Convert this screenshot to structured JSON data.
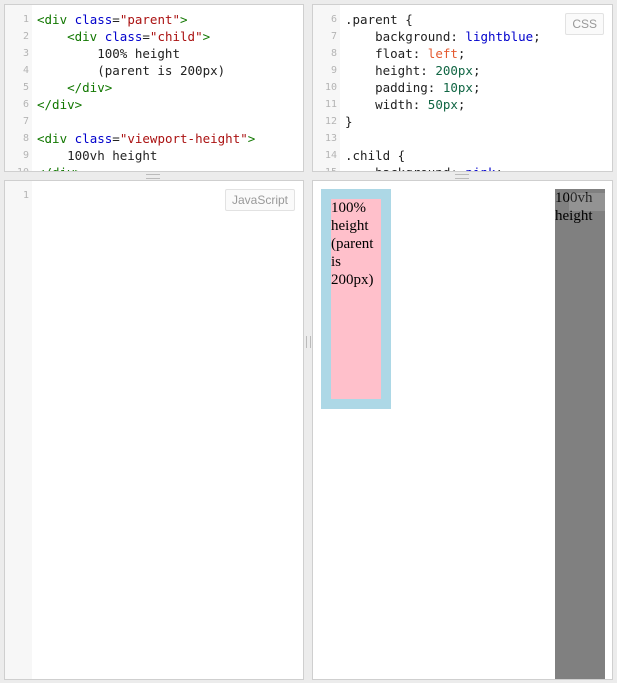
{
  "html_pane": {
    "label": "",
    "lines": [
      {
        "n": "1",
        "parts": [
          [
            "t",
            "<div "
          ],
          [
            "a",
            "class"
          ],
          [
            "p",
            "="
          ],
          [
            "s",
            "\"parent\""
          ],
          [
            "t",
            ">"
          ]
        ]
      },
      {
        "n": "2",
        "parts": [
          [
            "p",
            "    "
          ],
          [
            "t",
            "<div "
          ],
          [
            "a",
            "class"
          ],
          [
            "p",
            "="
          ],
          [
            "s",
            "\"child\""
          ],
          [
            "t",
            ">"
          ]
        ]
      },
      {
        "n": "3",
        "parts": [
          [
            "p",
            "        100% height"
          ]
        ]
      },
      {
        "n": "4",
        "parts": [
          [
            "p",
            "        (parent is 200px)"
          ]
        ]
      },
      {
        "n": "5",
        "parts": [
          [
            "p",
            "    "
          ],
          [
            "t",
            "</div>"
          ]
        ]
      },
      {
        "n": "6",
        "parts": [
          [
            "t",
            "</div>"
          ]
        ]
      },
      {
        "n": "7",
        "parts": [
          [
            "p",
            ""
          ]
        ]
      },
      {
        "n": "8",
        "parts": [
          [
            "t",
            "<div "
          ],
          [
            "a",
            "class"
          ],
          [
            "p",
            "="
          ],
          [
            "s",
            "\"viewport-height\""
          ],
          [
            "t",
            ">"
          ]
        ]
      },
      {
        "n": "9",
        "parts": [
          [
            "p",
            "    100vh height"
          ]
        ]
      },
      {
        "n": "10",
        "parts": [
          [
            "t",
            "</div>"
          ]
        ]
      }
    ]
  },
  "css_pane": {
    "label": "CSS",
    "lines": [
      {
        "n": "6",
        "parts": [
          [
            "p",
            ".parent {"
          ]
        ]
      },
      {
        "n": "7",
        "parts": [
          [
            "p",
            "    background: "
          ],
          [
            "kw",
            "lightblue"
          ],
          [
            "p",
            ";"
          ]
        ]
      },
      {
        "n": "8",
        "parts": [
          [
            "p",
            "    float: "
          ],
          [
            "red",
            "left"
          ],
          [
            "p",
            ";"
          ]
        ]
      },
      {
        "n": "9",
        "parts": [
          [
            "p",
            "    height: "
          ],
          [
            "num",
            "200px"
          ],
          [
            "p",
            ";"
          ]
        ]
      },
      {
        "n": "10",
        "parts": [
          [
            "p",
            "    padding: "
          ],
          [
            "num",
            "10px"
          ],
          [
            "p",
            ";"
          ]
        ]
      },
      {
        "n": "11",
        "parts": [
          [
            "p",
            "    width: "
          ],
          [
            "num",
            "50px"
          ],
          [
            "p",
            ";"
          ]
        ]
      },
      {
        "n": "12",
        "parts": [
          [
            "p",
            "}"
          ]
        ]
      },
      {
        "n": "13",
        "parts": [
          [
            "p",
            ""
          ]
        ]
      },
      {
        "n": "14",
        "parts": [
          [
            "p",
            ".child {"
          ]
        ]
      },
      {
        "n": "15",
        "parts": [
          [
            "p",
            "    background: "
          ],
          [
            "kw",
            "pink"
          ],
          [
            "p",
            ";"
          ]
        ]
      }
    ]
  },
  "js_pane": {
    "label": "JavaScript",
    "lines": [
      {
        "n": "1",
        "parts": [
          [
            "p",
            ""
          ]
        ]
      }
    ]
  },
  "result_pane": {
    "child_text": [
      "100%",
      "height",
      "(parent",
      "is",
      "200px)"
    ],
    "vh_text": [
      "100vh",
      "height"
    ]
  }
}
